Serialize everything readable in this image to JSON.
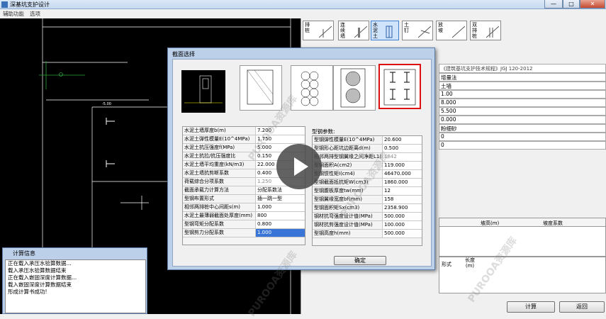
{
  "window": {
    "title": "深基坑支护设计",
    "controls": [
      "—",
      "□",
      "✕"
    ]
  },
  "menu": [
    "辅助功能",
    "选项"
  ],
  "toolbar": [
    {
      "label": "排桩"
    },
    {
      "label": "连续墙"
    },
    {
      "label": "水泥土"
    },
    {
      "label": "土钉"
    },
    {
      "label": "放坡"
    },
    {
      "label": "双排桩"
    }
  ],
  "right_panel": {
    "spec": "《建筑基坑支护技术规程》JGJ 120-2012",
    "values": [
      "增量法",
      "土墙",
      "1.00",
      "8.000",
      "5.500",
      "0.000",
      "粉细砂",
      "0",
      "0"
    ],
    "table1_headers": [
      "",
      "坡高(m)",
      "坡度系数"
    ],
    "table2_headers": [
      "形式",
      "长度(m)"
    ],
    "buttons": {
      "calc": "计算",
      "back": "返回"
    }
  },
  "cad": {
    "level_label": "-5.00"
  },
  "dialog": {
    "title": "截面选择",
    "left_params": [
      {
        "k": "水泥土墙厚度b(m)",
        "v": "7.200"
      },
      {
        "k": "水泥土弹性模量E(10^4MPa)",
        "v": "1.750"
      },
      {
        "k": "水泥土抗压强度f(MPa)",
        "v": "5.000"
      },
      {
        "k": "水泥土抗拉/抗压强度比",
        "v": "0.150"
      },
      {
        "k": "水泥土墙平均重度(kN/m3)",
        "v": "22.000"
      },
      {
        "k": "水泥土墙抗剪断系数",
        "v": "0.400"
      },
      {
        "k": "荷载综合分项系数",
        "v": "1.250",
        "gray": true
      },
      {
        "k": "截面承载力计算方法",
        "v": "分配系数法"
      },
      {
        "k": "型钢布置形式",
        "v": "插一跳一型"
      },
      {
        "k": "相邻两排桩中心间距s(m)",
        "v": "1.000"
      },
      {
        "k": "水泥土最薄弱截面处厚度(mm)",
        "v": "800"
      },
      {
        "k": "型钢弯矩分配系数",
        "v": "0.800"
      },
      {
        "k": "型钢剪力分配系数",
        "v": "1.000",
        "selected": true
      }
    ],
    "right_header": "型钢参数:",
    "right_params": [
      {
        "k": "型钢弹性模量E(10^4MPa)",
        "v": "20.600"
      },
      {
        "k": "型钢形心距坑边距离d(m)",
        "v": "0.500"
      },
      {
        "k": "相邻两排型钢翼缘之间净距L1(mm)",
        "v": "1842",
        "gray": true
      },
      {
        "k": "型钢面积A(cm2)",
        "v": "119.000"
      },
      {
        "k": "型钢惯性矩I(cm4)",
        "v": "46470.000"
      },
      {
        "k": "型钢截面抵抗矩W(cm3)",
        "v": "1860.000"
      },
      {
        "k": "型钢腹板厚度tw(mm)",
        "v": "12"
      },
      {
        "k": "型钢翼缘宽度bf(mm)",
        "v": "158"
      },
      {
        "k": "型钢面积矩Sx(cm3)",
        "v": "2358.900"
      },
      {
        "k": "钢材抗弯强度设计值(MPa)",
        "v": "500.000"
      },
      {
        "k": "钢材抗剪强度设计值(MPa)",
        "v": "100.000"
      },
      {
        "k": "型钢高度h(mm)",
        "v": "500.000"
      }
    ],
    "ok_label": "确定"
  },
  "log": {
    "title": "计算信息",
    "lines": [
      "正在载入承压水验算数据...",
      "载入承压水验算数据结束",
      "正在载入嵌固深度计算数据...",
      "载入嵌固深度计算数据结束",
      "形成计算书成功!"
    ]
  },
  "watermark": "PUROOA资源库"
}
